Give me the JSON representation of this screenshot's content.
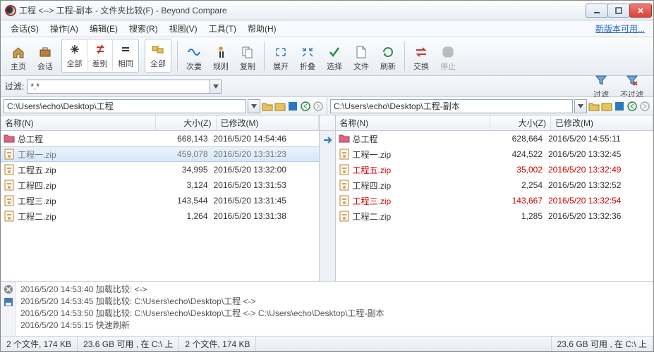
{
  "title": "工程 <--> 工程-副本 - 文件夹比较(F) - Beyond Compare",
  "menu": [
    "会话(S)",
    "操作(A)",
    "编辑(E)",
    "搜索(R)",
    "视图(V)",
    "工具(T)",
    "帮助(H)"
  ],
  "new_version": "新版本可用...",
  "toolbar": {
    "home": "主页",
    "session": "会话",
    "all": "全部",
    "diff": "差别",
    "same": "相同",
    "all2": "全部",
    "next": "次要",
    "rules": "规则",
    "copy": "复制",
    "expand": "展开",
    "collapse": "折叠",
    "select": "选择",
    "file": "文件",
    "refresh": "刷新",
    "swap": "交换",
    "stop": "停止"
  },
  "filter": {
    "label": "过滤:",
    "value": "*.*",
    "filter": "过滤",
    "nofilter": "不过滤"
  },
  "paths": {
    "left": "C:\\Users\\echo\\Desktop\\工程",
    "right": "C:\\Users\\echo\\Desktop\\工程-副本"
  },
  "headers": {
    "name": "名称(N)",
    "size": "大小(Z)",
    "mod": "已修改(M)"
  },
  "left_rows": [
    {
      "icon": "folder",
      "name": "总工程",
      "size": "668,143",
      "mod": "2016/5/20 14:54:46",
      "cls": ""
    },
    {
      "icon": "zip",
      "name": "工程一.zip",
      "size": "459,078",
      "mod": "2016/5/20 13:31:23",
      "cls": "sel gray"
    },
    {
      "icon": "zip",
      "name": "工程五.zip",
      "size": "34,995",
      "mod": "2016/5/20 13:32:00",
      "cls": ""
    },
    {
      "icon": "zip",
      "name": "工程四.zip",
      "size": "3,124",
      "mod": "2016/5/20 13:31:53",
      "cls": ""
    },
    {
      "icon": "zip",
      "name": "工程三.zip",
      "size": "143,544",
      "mod": "2016/5/20 13:31:45",
      "cls": ""
    },
    {
      "icon": "zip",
      "name": "工程二.zip",
      "size": "1,264",
      "mod": "2016/5/20 13:31:38",
      "cls": ""
    }
  ],
  "right_rows": [
    {
      "icon": "folder",
      "name": "总工程",
      "size": "628,664",
      "mod": "2016/5/20 14:55:11",
      "cls": ""
    },
    {
      "icon": "zip",
      "name": "工程一.zip",
      "size": "424,522",
      "mod": "2016/5/20 13:32:45",
      "cls": ""
    },
    {
      "icon": "zip",
      "name": "工程五.zip",
      "size": "35,002",
      "mod": "2016/5/20 13:32:49",
      "cls": "diff"
    },
    {
      "icon": "zip",
      "name": "工程四.zip",
      "size": "2,254",
      "mod": "2016/5/20 13:32:52",
      "cls": ""
    },
    {
      "icon": "zip",
      "name": "工程三.zip",
      "size": "143,667",
      "mod": "2016/5/20 13:32:54",
      "cls": "diff"
    },
    {
      "icon": "zip",
      "name": "工程二.zip",
      "size": "1,285",
      "mod": "2016/5/20 13:32:36",
      "cls": ""
    }
  ],
  "log": [
    "2016/5/20 14:53:40  加载比较:  <->",
    "2016/5/20 14:53:45  加载比较: C:\\Users\\echo\\Desktop\\工程 <->",
    "2016/5/20 14:53:50  加载比较: C:\\Users\\echo\\Desktop\\工程 <-> C:\\Users\\echo\\Desktop\\工程-副本",
    "2016/5/20 14:55:15  快速刷新"
  ],
  "status": {
    "left": "2 个文件, 174 KB",
    "leftfree": "23.6 GB 可用 , 在 C:\\ 上",
    "right": "2 个文件, 174 KB",
    "rightfree": "23.6 GB 可用 , 在 C:\\ 上"
  }
}
